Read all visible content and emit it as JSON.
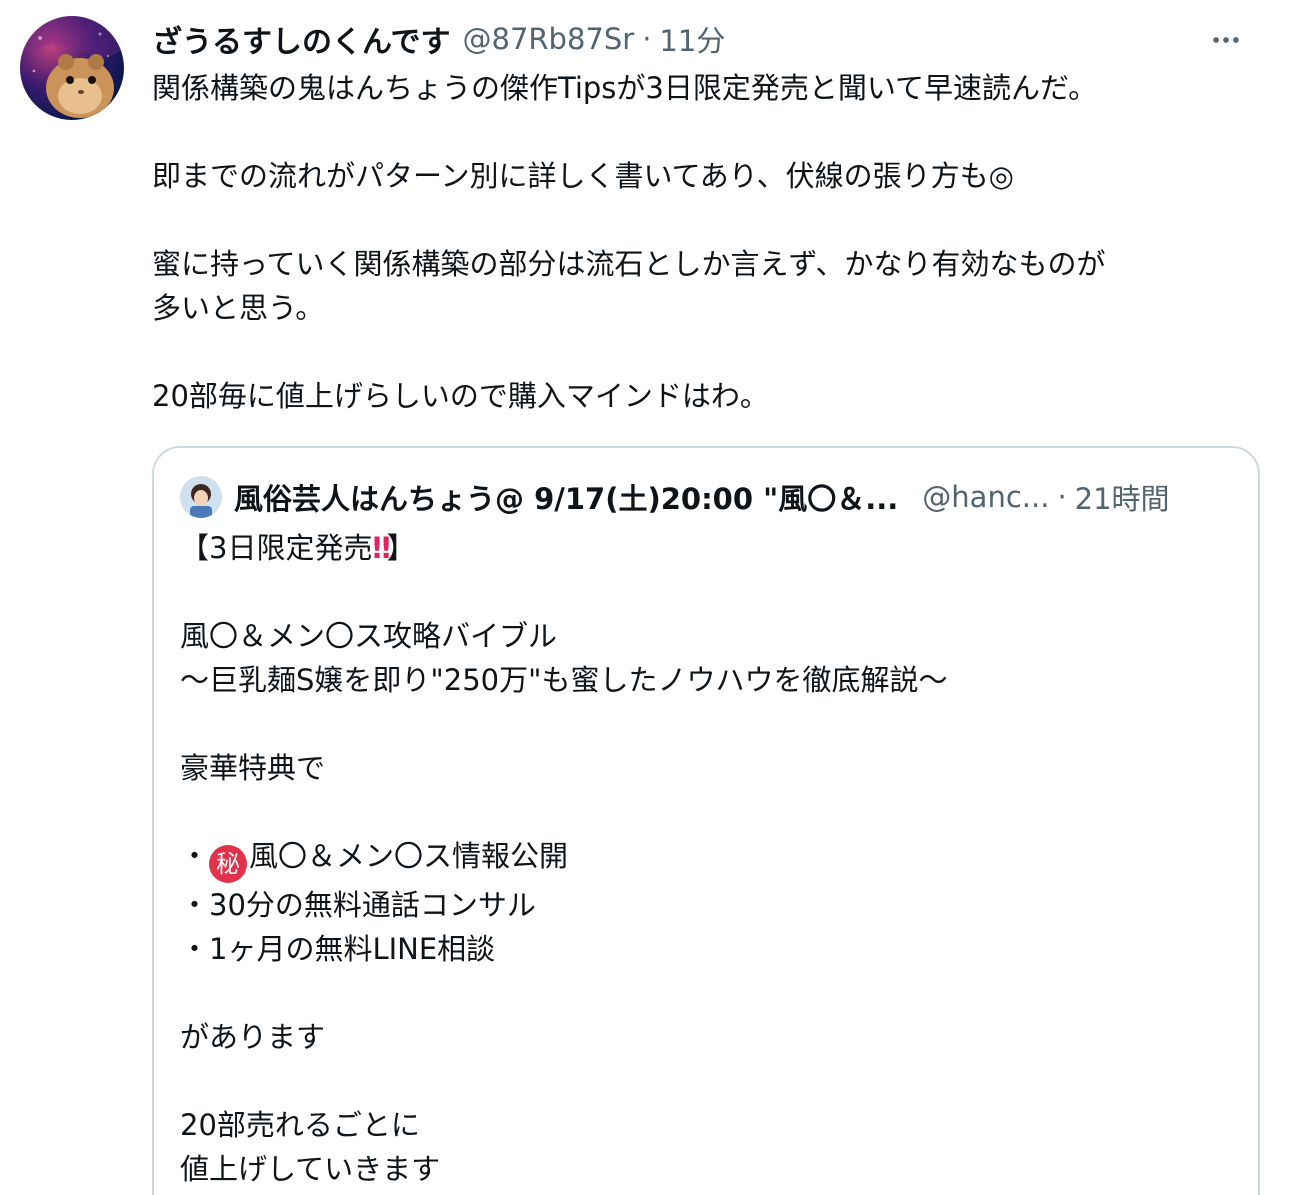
{
  "tweet": {
    "display_name": "ざうるすしのくんです",
    "handle": "@87Rb87Sr",
    "separator": "·",
    "time": "11分",
    "more_icon": "more-horizontal-icon",
    "lines": [
      "関係構築の鬼はんちょうの傑作Tipsが3日限定発売と聞いて早速読んだ。",
      "",
      "即までの流れがパターン別に詳しく書いてあり、伏線の張り方も◎",
      "",
      "蜜に持っていく関係構築の部分は流石としか言えず、かなり有効なものが",
      "多いと思う。",
      "",
      "20部毎に値上げらしいので購入マインドはわ。"
    ]
  },
  "quoted_tweet": {
    "display_name": "風俗芸人はんちょう@ 9/17(土)20:00 \"風〇＆...",
    "handle": "@hanc...",
    "separator": "·",
    "time": "21時間",
    "title_prefix": "【3日限定発売",
    "title_emoji": "‼",
    "title_suffix": "】",
    "line_product": "風〇＆メン〇ス攻略バイブル",
    "line_subtitle": "〜巨乳麺S嬢を即り\"250万\"も蜜したノウハウを徹底解説〜",
    "line_bonus_heading": "豪華特典で",
    "bonus_1_prefix": "・",
    "bonus_1_badge": "秘",
    "bonus_1_text": "風〇＆メン〇ス情報公開",
    "bonus_2": "・30分の無料通話コンサル",
    "bonus_3": "・1ヶ月の無料LINE相談",
    "line_there_is": "があります",
    "line_every20": "20部売れるごとに",
    "line_raise": "値上げしていきます"
  },
  "colors": {
    "text": "#0f1419",
    "secondary": "#536471",
    "border": "#cfd9de",
    "emoji_red": "#e0245e",
    "badge_red": "#e0324a"
  }
}
